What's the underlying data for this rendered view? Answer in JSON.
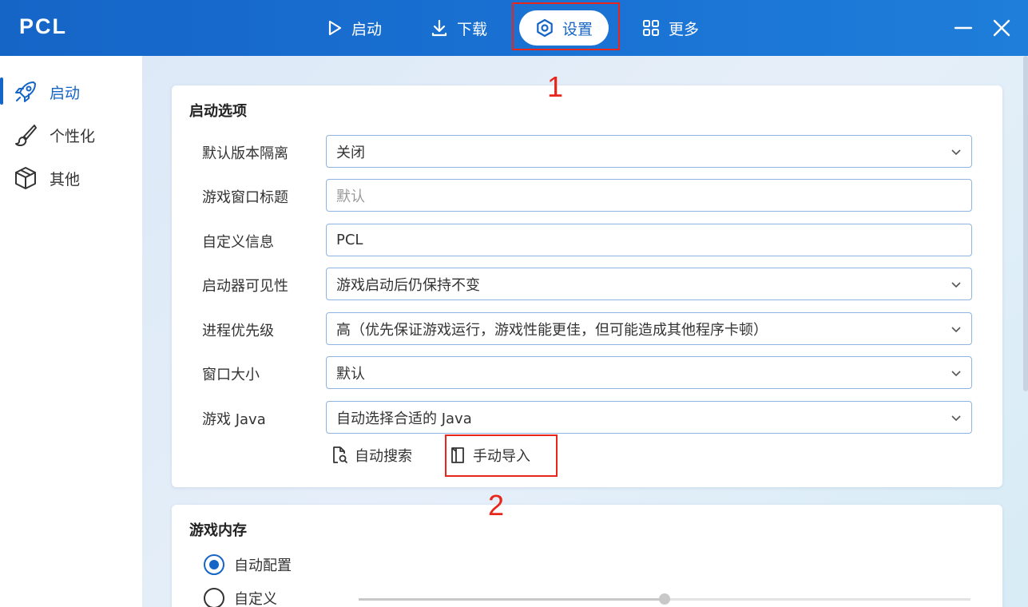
{
  "app": {
    "title": "PCL"
  },
  "nav": {
    "launch": "启动",
    "download": "下载",
    "settings": "设置",
    "more": "更多"
  },
  "sidebar": {
    "items": [
      {
        "label": "启动",
        "icon": "rocket-icon",
        "active": true
      },
      {
        "label": "个性化",
        "icon": "brush-icon",
        "active": false
      },
      {
        "label": "其他",
        "icon": "box-icon",
        "active": false
      }
    ]
  },
  "launch_options": {
    "title": "启动选项",
    "rows": [
      {
        "label": "默认版本隔离",
        "value": "关闭",
        "type": "select"
      },
      {
        "label": "游戏窗口标题",
        "placeholder": "默认",
        "type": "input"
      },
      {
        "label": "自定义信息",
        "value": "PCL",
        "type": "input"
      },
      {
        "label": "启动器可见性",
        "value": "游戏启动后仍保持不变",
        "type": "select"
      },
      {
        "label": "进程优先级",
        "value": "高（优先保证游戏运行，游戏性能更佳，但可能造成其他程序卡顿）",
        "type": "select"
      },
      {
        "label": "窗口大小",
        "value": "默认",
        "type": "select"
      },
      {
        "label": "游戏 Java",
        "value": "自动选择合适的 Java",
        "type": "select"
      }
    ],
    "auto_search": "自动搜索",
    "manual_import": "手动导入"
  },
  "memory": {
    "title": "游戏内存",
    "options": [
      {
        "label": "自动配置",
        "selected": true
      },
      {
        "label": "自定义",
        "selected": false
      }
    ],
    "slider_value_fraction": 0.5
  },
  "annotations": {
    "first": "1",
    "second": "2"
  },
  "colors": {
    "accent": "#1565c7",
    "annotation": "#e8261c"
  }
}
